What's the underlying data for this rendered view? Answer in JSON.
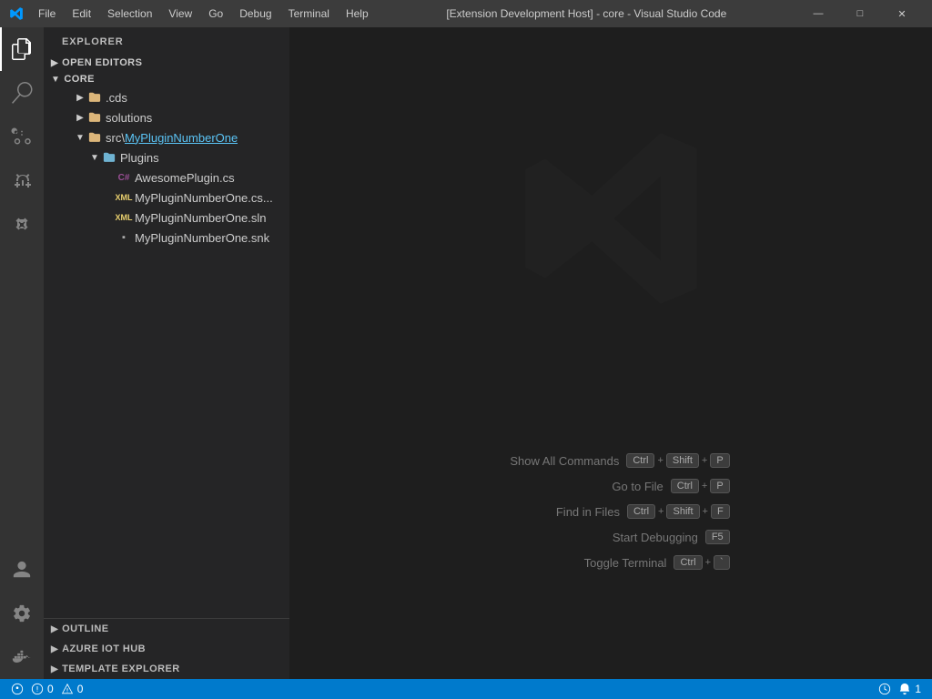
{
  "titlebar": {
    "title": "[Extension Development Host] - core - Visual Studio Code",
    "menus": [
      "File",
      "Edit",
      "Selection",
      "View",
      "Go",
      "Debug",
      "Terminal",
      "Help"
    ],
    "win_buttons": [
      "—",
      "❐",
      "✕"
    ]
  },
  "sidebar": {
    "header": "EXPLORER",
    "sections": {
      "open_editors": "OPEN EDITORS",
      "core": "CORE"
    },
    "files": [
      {
        "name": ".cds",
        "type": "folder",
        "indent": 1,
        "open": false
      },
      {
        "name": "solutions",
        "type": "folder",
        "indent": 1,
        "open": false
      },
      {
        "name": "src\\MyPluginNumberOne",
        "type": "folder-special",
        "indent": 1,
        "open": true
      },
      {
        "name": "Plugins",
        "type": "folder-blue",
        "indent": 2,
        "open": true
      },
      {
        "name": "AwesomePlugin.cs",
        "type": "file-cs",
        "indent": 3
      },
      {
        "name": "MyPluginNumberOne.cs...",
        "type": "file-xml",
        "indent": 3
      },
      {
        "name": "MyPluginNumberOne.sln",
        "type": "file-sln",
        "indent": 3
      },
      {
        "name": "MyPluginNumberOne.snk",
        "type": "file-snk",
        "indent": 3
      }
    ]
  },
  "bottom_sections": [
    {
      "label": "OUTLINE",
      "collapsed": true
    },
    {
      "label": "AZURE IOT HUB",
      "collapsed": true
    },
    {
      "label": "TEMPLATE EXPLORER",
      "collapsed": true
    }
  ],
  "shortcuts": [
    {
      "label": "Show All Commands",
      "keys": [
        "Ctrl",
        "+",
        "Shift",
        "+",
        "P"
      ]
    },
    {
      "label": "Go to File",
      "keys": [
        "Ctrl",
        "+",
        "P"
      ]
    },
    {
      "label": "Find in Files",
      "keys": [
        "Ctrl",
        "+",
        "Shift",
        "+",
        "F"
      ]
    },
    {
      "label": "Start Debugging",
      "keys": [
        "F5"
      ]
    },
    {
      "label": "Toggle Terminal",
      "keys": [
        "Ctrl",
        "+",
        "`"
      ]
    }
  ],
  "statusbar": {
    "left": [
      {
        "icon": "git-icon",
        "text": "⓪"
      },
      {
        "icon": "error-icon",
        "text": "⊘ 0"
      },
      {
        "icon": "warning-icon",
        "text": "△ 0"
      }
    ],
    "right": [
      {
        "icon": "clock-icon",
        "text": "⊙"
      },
      {
        "icon": "bell-icon",
        "text": "🔔 1"
      }
    ]
  },
  "activity_bar": {
    "top_icons": [
      {
        "name": "explorer-icon",
        "symbol": "⬜",
        "active": true
      },
      {
        "name": "search-icon",
        "symbol": "🔍"
      },
      {
        "name": "source-control-icon",
        "symbol": "⎇"
      },
      {
        "name": "debug-icon",
        "symbol": "🐛"
      },
      {
        "name": "extensions-icon",
        "symbol": "⚡"
      }
    ],
    "bottom_icons": [
      {
        "name": "remote-icon",
        "symbol": "⚙"
      },
      {
        "name": "account-icon",
        "symbol": "👤"
      },
      {
        "name": "docker-icon",
        "symbol": "🐳"
      }
    ]
  }
}
